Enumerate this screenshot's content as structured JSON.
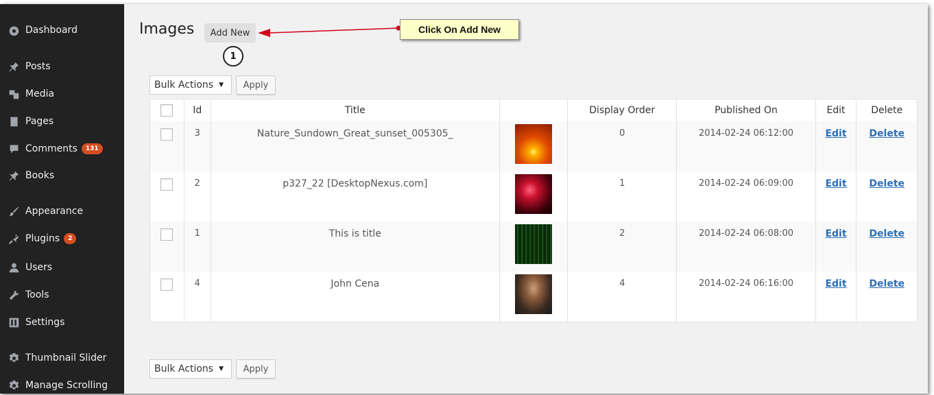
{
  "sidebar": {
    "items": [
      {
        "label": "Dashboard",
        "icon": "dashboard-icon"
      },
      {
        "label": "Posts",
        "icon": "pin-icon"
      },
      {
        "label": "Media",
        "icon": "media-icon"
      },
      {
        "label": "Pages",
        "icon": "pages-icon"
      },
      {
        "label": "Comments",
        "icon": "comment-icon",
        "badge": "131"
      },
      {
        "label": "Books",
        "icon": "pin-icon"
      },
      {
        "label": "Appearance",
        "icon": "brush-icon"
      },
      {
        "label": "Plugins",
        "icon": "plugin-icon",
        "badge": "2"
      },
      {
        "label": "Users",
        "icon": "users-icon"
      },
      {
        "label": "Tools",
        "icon": "wrench-icon"
      },
      {
        "label": "Settings",
        "icon": "settings-icon"
      },
      {
        "label": "Thumbnail Slider",
        "icon": "gear-icon"
      },
      {
        "label": "Manage Scrolling",
        "icon": "gear-icon"
      }
    ]
  },
  "header": {
    "title": "Images",
    "add_new_label": "Add New"
  },
  "annotation": {
    "callout_text": "Click On Add New",
    "step_number": "1"
  },
  "bulk_top": {
    "select_label": "Bulk Actions",
    "apply_label": "Apply"
  },
  "bulk_bottom": {
    "select_label": "Bulk Actions",
    "apply_label": "Apply"
  },
  "table": {
    "columns": [
      "",
      "Id",
      "Title",
      "",
      "Display Order",
      "Published On",
      "Edit",
      "Delete"
    ],
    "rows": [
      {
        "id": "3",
        "title": "Nature_Sundown_Great_sunset_005305_",
        "thumb": "sunset-thumbnail",
        "display_order": "0",
        "published_on": "2014-02-24 06:12:00",
        "edit": "Edit",
        "delete": "Delete"
      },
      {
        "id": "2",
        "title": "p327_22 [DesktopNexus.com]",
        "thumb": "heart-thumbnail",
        "display_order": "1",
        "published_on": "2014-02-24 06:09:00",
        "edit": "Edit",
        "delete": "Delete"
      },
      {
        "id": "1",
        "title": "This is title",
        "thumb": "matrix-thumbnail",
        "display_order": "2",
        "published_on": "2014-02-24 06:08:00",
        "edit": "Edit",
        "delete": "Delete"
      },
      {
        "id": "4",
        "title": "John Cena",
        "thumb": "wrestler-thumbnail",
        "display_order": "4",
        "published_on": "2014-02-24 06:16:00",
        "edit": "Edit",
        "delete": "Delete"
      }
    ]
  },
  "colors": {
    "sidebar_bg": "#222222",
    "badge": "#d54e21",
    "link": "#2a6fb8",
    "callout_bg": "#ffffc8",
    "arrow": "#d0021b"
  }
}
